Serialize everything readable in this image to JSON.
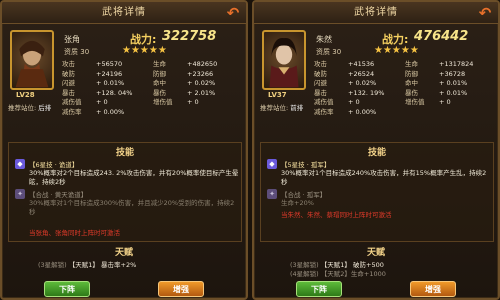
{
  "left": {
    "title": "武将详情",
    "name": "张角",
    "power_label": "战力:",
    "power": "322758",
    "quality_label": "资质",
    "quality": "30",
    "stars": "★★★★★",
    "level": "LV28",
    "recommend_label": "推荐站位:",
    "recommend": "后排",
    "stats": [
      [
        {
          "k": "攻击",
          "v": "+56570"
        },
        {
          "k": "生命",
          "v": "+482650"
        }
      ],
      [
        {
          "k": "破防",
          "v": "+24196"
        },
        {
          "k": "防御",
          "v": "+23266"
        }
      ],
      [
        {
          "k": "闪避",
          "v": "+ 0.01%"
        },
        {
          "k": "命中",
          "v": "+ 0.02%"
        }
      ],
      [
        {
          "k": "暴击",
          "v": "+128. 04%"
        },
        {
          "k": "暴伤",
          "v": "+ 2.01%"
        }
      ],
      [
        {
          "k": "减伤值",
          "v": "+ 0"
        },
        {
          "k": "增伤值",
          "v": "+ 0"
        }
      ],
      [
        {
          "k": "减伤率",
          "v": "+ 0.00%"
        },
        {
          "k": "",
          "v": ""
        }
      ]
    ],
    "skill_title": "技能",
    "skill1_name": "【6星技 · 诡道】",
    "skill1_desc": "30%概率对2个目标造成243. 2%攻击伤害，并有20%概率使目标产生晕眩，持续2秒",
    "skill2_name": "【合战 · 黄天诡道】",
    "skill2_desc": "30%概率对1个目标造成300%伤害，并且减少20%受到的伤害，持续2秒",
    "skill2_warn": "当张角、张角同时上阵时可激活",
    "talent_title": "天赋",
    "talent_line": "(3星解锁)",
    "talent_name": "【天赋1】",
    "talent_value": "暴击率+2%",
    "btn_down": "下阵",
    "btn_up": "增强"
  },
  "right": {
    "title": "武将详情",
    "name": "朱然",
    "power_label": "战力:",
    "power": "476442",
    "quality_label": "资质",
    "quality": "30",
    "stars": "★★★★★",
    "level": "LV37",
    "recommend_label": "推荐站位:",
    "recommend": "前排",
    "stats": [
      [
        {
          "k": "攻击",
          "v": "+41536"
        },
        {
          "k": "生命",
          "v": "+1317824"
        }
      ],
      [
        {
          "k": "破防",
          "v": "+26524"
        },
        {
          "k": "防御",
          "v": "+36728"
        }
      ],
      [
        {
          "k": "闪避",
          "v": "+ 0.02%"
        },
        {
          "k": "命中",
          "v": "+ 0.01%"
        }
      ],
      [
        {
          "k": "暴击",
          "v": "+132. 19%"
        },
        {
          "k": "暴伤",
          "v": "+ 0.01%"
        }
      ],
      [
        {
          "k": "减伤值",
          "v": "+ 0"
        },
        {
          "k": "增伤值",
          "v": "+ 0"
        }
      ],
      [
        {
          "k": "减伤率",
          "v": "+ 0.00%"
        },
        {
          "k": "",
          "v": ""
        }
      ]
    ],
    "skill_title": "技能",
    "skill1_name": "【5星技 · 孤军】",
    "skill1_desc": "30%概率对1个目标造成240%攻击伤害，并有15%概率产生乱，持续2秒",
    "skill2_name": "【合战 · 孤军】",
    "skill2_desc": "生命+20%",
    "skill2_warn": "当朱然、朱然、蔡瑁同时上阵时可激活",
    "talent_title": "天赋",
    "talent_line": "(3星解锁)",
    "talent_name": "【天赋1】",
    "talent_value": "破防+500",
    "talent_line2": "(4星解锁) 【天赋2】生命+1000",
    "btn_down": "下阵",
    "btn_up": "增强"
  }
}
